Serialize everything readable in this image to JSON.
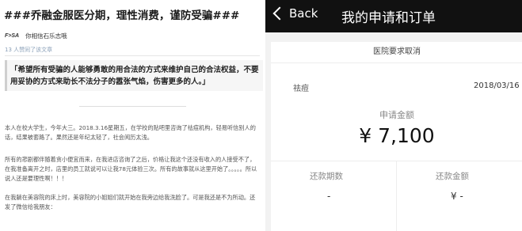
{
  "article": {
    "title": "###乔融金服医分期，理性消费，谨防受骗###",
    "author_logo": "F>SA",
    "author_name": "你相信石乐志哦",
    "likes": "13 人赞同了该文章",
    "quote": "「希望所有受骗的人能够勇敢的用合法的方式来维护自己的合法权益，不要用妥协的方式来助长不法分子的嚣张气焰，伤害更多的人。」",
    "paragraphs": [
      "本人在校大学生，今年大三。2018.3.16星期五，在学校的贴吧里咨询了祛痘机构，轻易听信别人的话，结果被套路了。果然还是年纪太轻了，社会阅历太浅。",
      "所有的悲剧都伴随着贪小便宜而来，在我进店咨询了之后，价格让我这个还没有收入的人接受不了，在我准备离开之时，店里的员工就说可以让我78元体验三次。所有的故事就从这里开始了。。。。。所以说人还是要理性啊！！！",
      "在我躺在美容院的床上时，美容院的小姐姐们就开始在我旁边给我洗脸了。可是我还是不为所动。还发了微信给我朋友："
    ]
  },
  "phone": {
    "back_label": "Back",
    "title": "我的申请和订单",
    "status": "医院要求取消",
    "hospital": "祛痘",
    "date": "2018/03/16",
    "amount_label": "申请金额",
    "amount": "¥ 7,100",
    "periods_label": "还款期数",
    "periods_value": "-",
    "repay_label": "还款金额",
    "repay_value": "¥ -"
  }
}
